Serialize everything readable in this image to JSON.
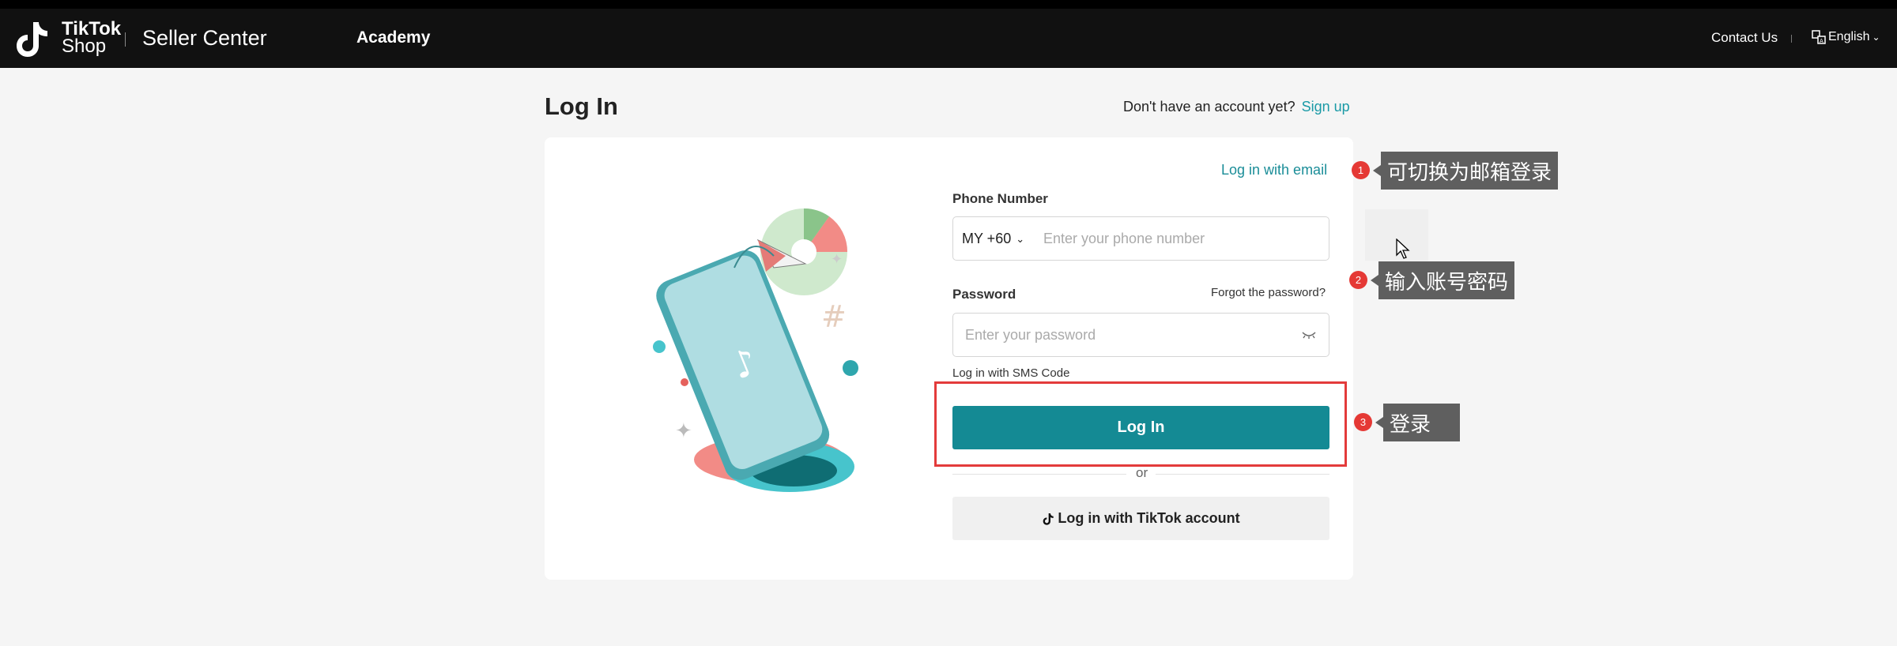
{
  "navbar": {
    "logo_line1": "TikTok",
    "logo_line2": "Shop",
    "brand": "Seller Center",
    "academy": "Academy",
    "contact": "Contact Us",
    "language": "English"
  },
  "page": {
    "title": "Log In",
    "no_account": "Don't have an account yet?",
    "sign_up": "Sign up"
  },
  "form": {
    "email_link": "Log in with email",
    "phone_label": "Phone Number",
    "country_code": "MY +60",
    "phone_placeholder": "Enter your phone number",
    "password_label": "Password",
    "forgot": "Forgot the password?",
    "password_placeholder": "Enter your password",
    "sms": "Log in with SMS Code",
    "login_button": "Log In",
    "or": "or",
    "tiktok_button": "Log in with TikTok account"
  },
  "annotations": [
    {
      "num": "1",
      "text": "可切换为邮箱登录"
    },
    {
      "num": "2",
      "text": "输入账号密码"
    },
    {
      "num": "3",
      "text": "登录"
    }
  ],
  "colors": {
    "accent": "#148a94",
    "link": "#1a9aa6",
    "highlight": "#e33b3b",
    "annotation_bg": "#5f5f5f"
  }
}
